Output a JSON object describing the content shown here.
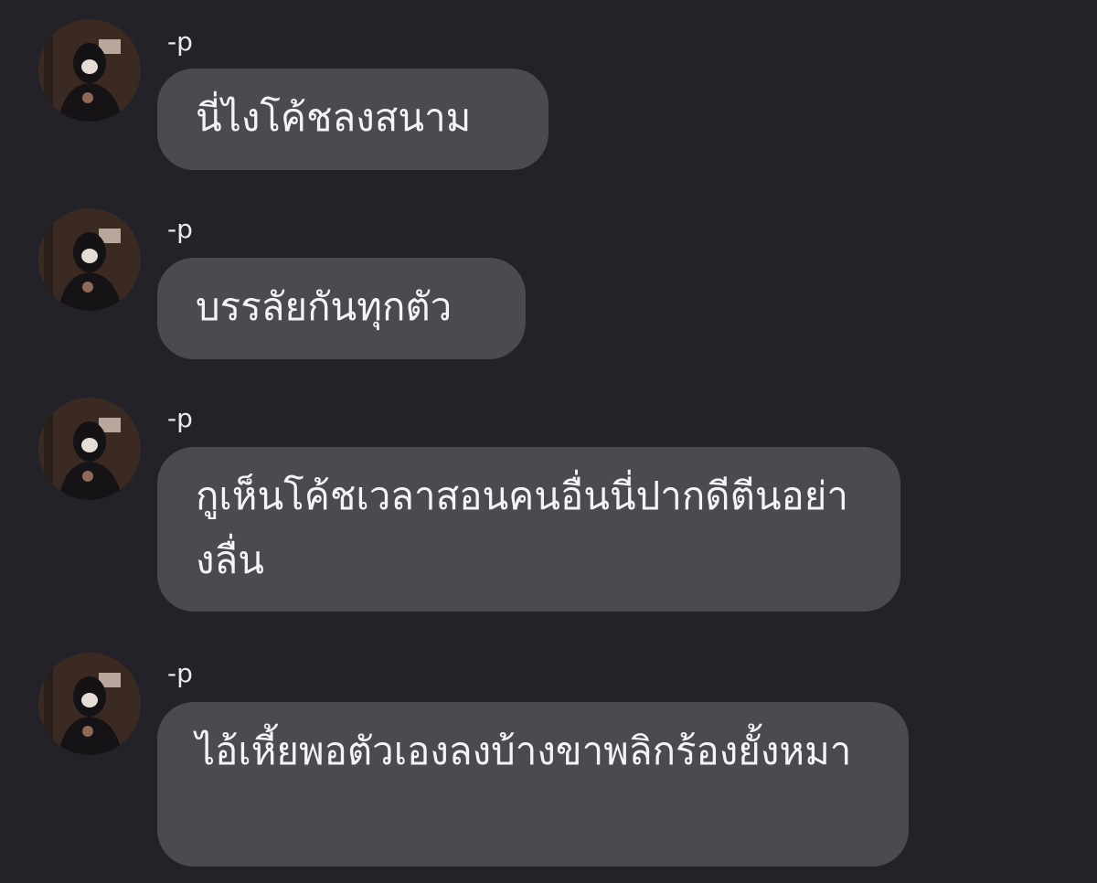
{
  "messages": [
    {
      "sender": "-p",
      "text": "นี่ไงโค้ชลงสนาม"
    },
    {
      "sender": "-p",
      "text": "บรรลัยกันทุกตัว"
    },
    {
      "sender": "-p",
      "text": "กูเห็นโค้ชเวลาสอนคนอื่นนี่ปากดีตีนอย่างลื่น"
    },
    {
      "sender": "-p",
      "text": "ไอ้เหี้ยพอตัวเองลงบ้างขาพลิกร้องยั้งหมา"
    }
  ],
  "icons": {
    "avatar": "profile-photo-hooded-person-mask"
  },
  "colors": {
    "background": "#232228",
    "bubble": "#4a4a50",
    "text": "#f4f4f6"
  }
}
